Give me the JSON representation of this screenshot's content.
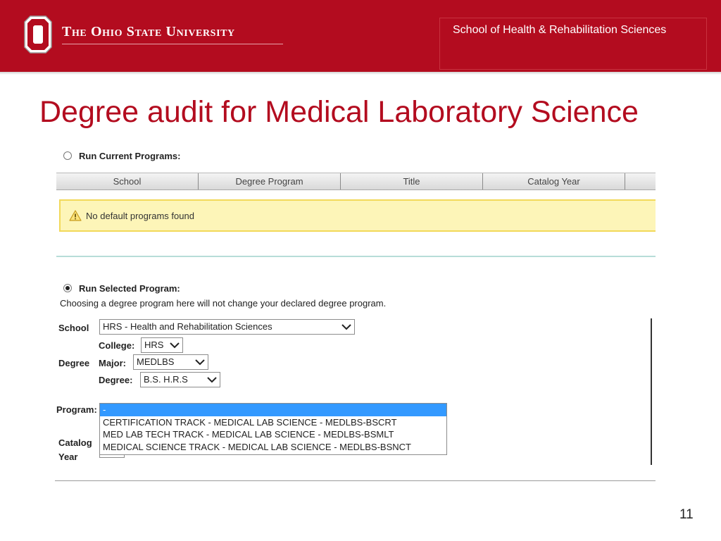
{
  "header": {
    "university_name": "The Ohio State University",
    "school_name": "School of Health & Rehabilitation Sciences",
    "logo_icon": "block-o-logo-icon",
    "brand_color": "#b30c1f"
  },
  "slide": {
    "title": "Degree audit for Medical Laboratory Science",
    "page_number": "11"
  },
  "current_programs": {
    "radio_label": "Run Current Programs:",
    "selected": false,
    "columns": [
      "School",
      "Degree Program",
      "Title",
      "Catalog Year",
      ""
    ],
    "warning_icon": "warning-triangle-icon",
    "warning_text": "No default programs found"
  },
  "selected_program": {
    "radio_label": "Run Selected Program:",
    "selected": true,
    "note": "Choosing a degree program here will not change your declared degree program.",
    "school_label": "School",
    "school_value": "HRS - Health and Rehabilitation Sciences",
    "degree_group_label": "Degree",
    "college_label": "College:",
    "college_value": "HRS",
    "major_label": "Major:",
    "major_value": "MEDLBS",
    "degree_label": "Degree:",
    "degree_value": "B.S. H.R.S",
    "program_label": "Program:",
    "program_options": [
      "-",
      "CERTIFICATION TRACK - MEDICAL LAB SCIENCE - MEDLBS-BSCRT",
      "MED LAB TECH TRACK - MEDICAL LAB SCIENCE - MEDLBS-BSMLT",
      "MEDICAL SCIENCE TRACK - MEDICAL LAB SCIENCE - MEDLBS-BSNCT"
    ],
    "program_selected_index": 0,
    "catalog_label_1": "Catalog",
    "catalog_label_2": "Year"
  }
}
